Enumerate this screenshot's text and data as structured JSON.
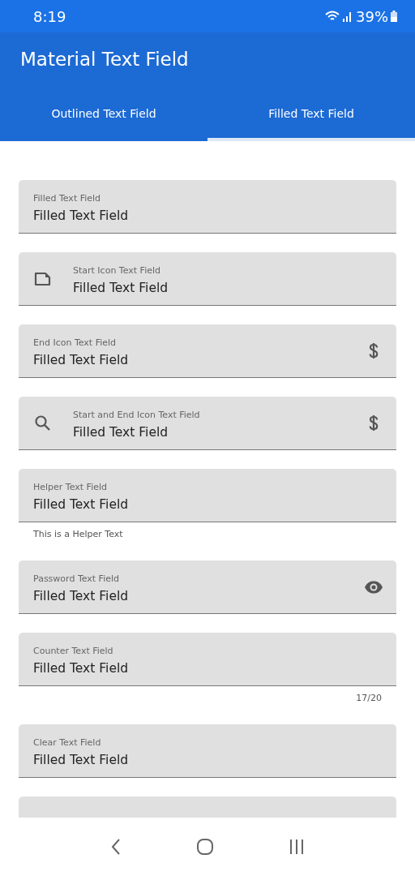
{
  "status_bar": {
    "time": "8:19",
    "battery": "39%"
  },
  "app_bar": {
    "title": "Material Text Field"
  },
  "tabs": [
    {
      "label": "Outlined Text Field",
      "selected": false
    },
    {
      "label": "Filled Text Field",
      "selected": true
    }
  ],
  "fields": [
    {
      "label": "Filled Text Field",
      "value": "Filled Text Field"
    },
    {
      "label": "Start Icon Text Field",
      "value": "Filled Text Field",
      "start_icon": {
        "kind": "file"
      }
    },
    {
      "label": "End Icon Text Field",
      "value": "Filled Text Field",
      "end_icon": {
        "kind": "dollar"
      }
    },
    {
      "label": "Start and End Icon Text Field",
      "value": "Filled Text Field",
      "start_icon": {
        "kind": "search"
      },
      "end_icon": {
        "kind": "dollar"
      }
    },
    {
      "label": "Helper Text Field",
      "value": "Filled Text Field",
      "helper": "This is a Helper Text"
    },
    {
      "label": "Password Text Field",
      "value": "Filled Text Field",
      "end_icon": {
        "kind": "eye"
      }
    },
    {
      "label": "Counter Text Field",
      "value": "Filled Text Field",
      "counter": "17/20"
    },
    {
      "label": "Clear Text Field",
      "value": "Filled Text Field"
    },
    {
      "kind": "partial"
    }
  ]
}
